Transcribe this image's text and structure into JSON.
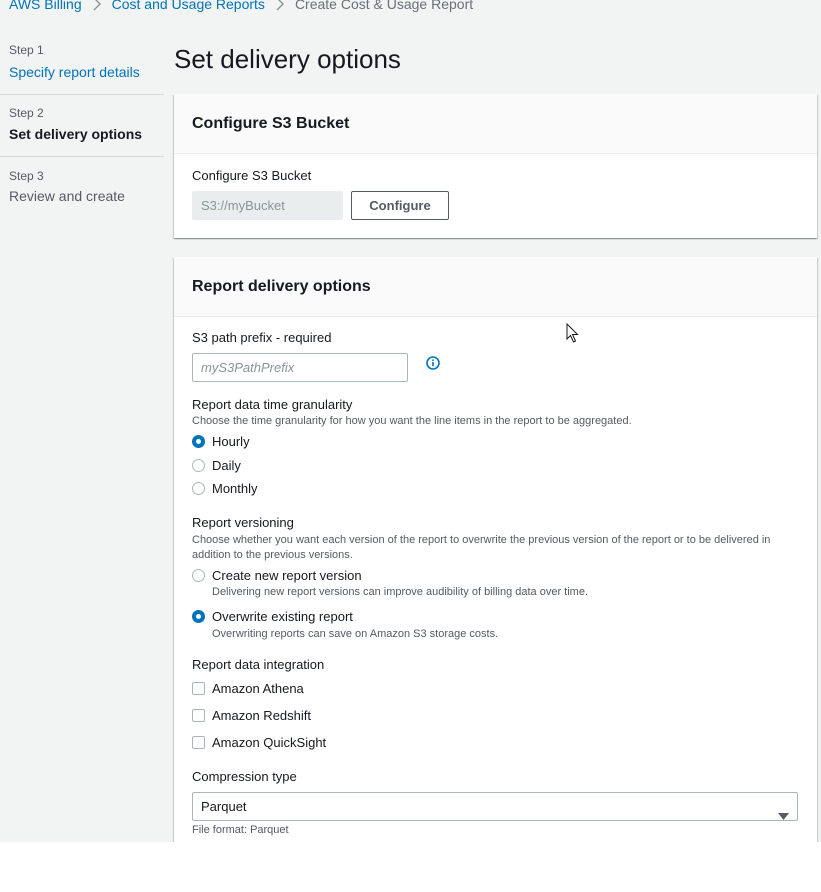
{
  "breadcrumb": {
    "items": [
      "AWS Billing",
      "Cost and Usage Reports",
      "Create Cost & Usage Report"
    ]
  },
  "steps": [
    {
      "number": "Step 1",
      "title": "Specify report details"
    },
    {
      "number": "Step 2",
      "title": "Set delivery options"
    },
    {
      "number": "Step 3",
      "title": "Review and create"
    }
  ],
  "page": {
    "title": "Set delivery options"
  },
  "s3_panel": {
    "title": "Configure S3 Bucket",
    "label": "Configure S3 Bucket",
    "input_placeholder": "S3://myBucket",
    "configure_button": "Configure"
  },
  "delivery_panel": {
    "title": "Report delivery options",
    "path_prefix": {
      "label": "S3 path prefix - required",
      "placeholder": "myS3PathPrefix"
    },
    "granularity": {
      "label": "Report data time granularity",
      "description": "Choose the time granularity for how you want the line items in the report to be aggregated.",
      "options": [
        "Hourly",
        "Daily",
        "Monthly"
      ],
      "selected": "Hourly"
    },
    "versioning": {
      "label": "Report versioning",
      "description": "Choose whether you want each version of the report to overwrite the previous version of the report or to be delivered in addition to the previous versions.",
      "options": [
        {
          "label": "Create new report version",
          "description": "Delivering new report versions can improve audibility of billing data over time."
        },
        {
          "label": "Overwrite existing report",
          "description": "Overwriting reports can save on Amazon S3 storage costs."
        }
      ],
      "selected": "Overwrite existing report"
    },
    "integration": {
      "label": "Report data integration",
      "options": [
        "Amazon Athena",
        "Amazon Redshift",
        "Amazon QuickSight"
      ]
    },
    "compression": {
      "label": "Compression type",
      "value": "Parquet",
      "hint": "File format: Parquet"
    }
  },
  "colors": {
    "link": "#0073bb",
    "background": "#f2f3f3",
    "text": "#16191f",
    "muted": "#545b64"
  }
}
